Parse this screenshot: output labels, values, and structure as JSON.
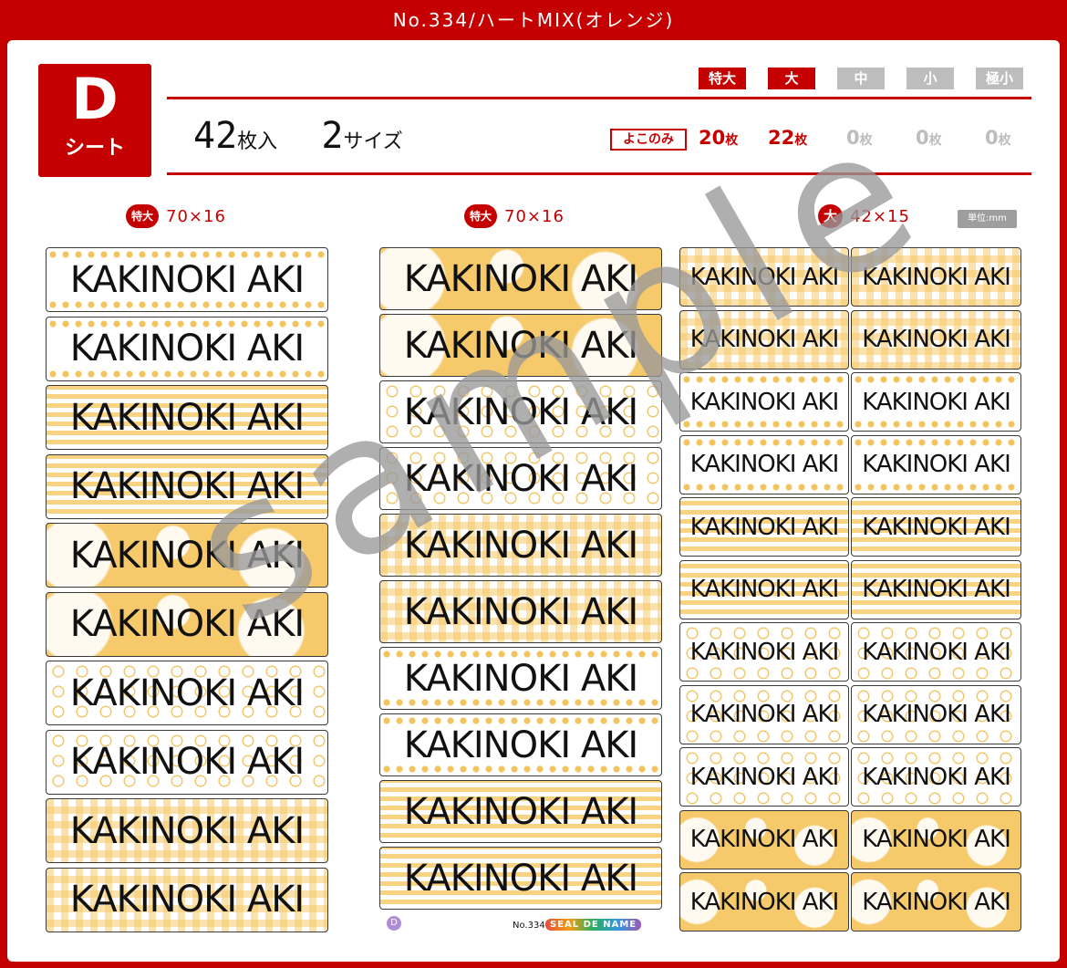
{
  "header": {
    "title": "No.334/ハートMIX(オレンジ)"
  },
  "badge": {
    "letter": "D",
    "sub": "シート"
  },
  "summary": {
    "count_num": "42",
    "count_unit": "枚入",
    "sizes_num": "2",
    "sizes_unit": "サイズ"
  },
  "sizes": [
    {
      "label": "特大",
      "qty": "20",
      "unit": "枚",
      "active": true
    },
    {
      "label": "大",
      "qty": "22",
      "unit": "枚",
      "active": true
    },
    {
      "label": "中",
      "qty": "0",
      "unit": "枚",
      "active": false
    },
    {
      "label": "小",
      "qty": "0",
      "unit": "枚",
      "active": false
    },
    {
      "label": "極小",
      "qty": "0",
      "unit": "枚",
      "active": false
    }
  ],
  "orientation": "よこのみ",
  "columns": [
    {
      "badge": "特大",
      "dim": "70×16"
    },
    {
      "badge": "特大",
      "dim": "70×16"
    },
    {
      "badge": "大",
      "dim": "42×15"
    }
  ],
  "unit_note": "単位:mm",
  "label_text": "KAKINOKI AKI",
  "watermark": "sample",
  "footer": {
    "sheet": "D",
    "number": "No.334",
    "brand": "SEAL DE NAME"
  },
  "colors": {
    "accent": "#c40000",
    "pattern": "#f6c96a",
    "inactive": "#bdbdbd"
  }
}
